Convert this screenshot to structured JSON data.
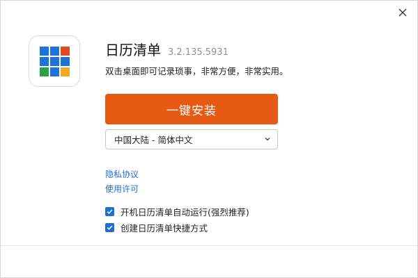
{
  "app": {
    "title": "日历清单",
    "version": "3.2.135.5931",
    "tagline": "双击桌面即可记录琐事，非常方便，非常实用。"
  },
  "icon": {
    "name": "calendar-grid-icon",
    "cells": [
      "#1e74d6",
      "#1e74d6",
      "#e04a1f",
      "#1e74d6",
      "#1e74d6",
      "#1e74d6",
      "#2ea043",
      "#1e74d6",
      "#f5a623"
    ]
  },
  "install": {
    "label": "一键安装",
    "color": "#e65a13"
  },
  "language": {
    "selected": "中国大陆 - 简体中文"
  },
  "links": {
    "privacy": "隐私协议",
    "license": "使用许可"
  },
  "options": {
    "autostart": {
      "label": "开机日历清单自动运行(强烈推荐)",
      "checked": true
    },
    "shortcut": {
      "label": "创建日历清单快捷方式",
      "checked": true
    }
  },
  "colors": {
    "accent": "#1f6fd1",
    "install": "#e65a13"
  }
}
